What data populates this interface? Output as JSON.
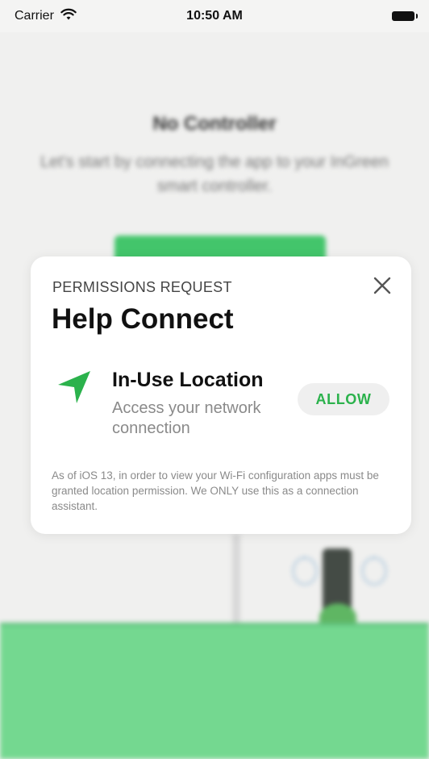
{
  "status_bar": {
    "carrier": "Carrier",
    "time": "10:50 AM",
    "wifi_icon": "wifi-icon",
    "battery_icon": "battery-icon"
  },
  "background": {
    "title": "No Controller",
    "subtitle": "Let's start by connecting the app to your InGreen smart controller."
  },
  "modal": {
    "eyebrow": "PERMISSIONS REQUEST",
    "title": "Help Connect",
    "close_icon": "close-icon",
    "permission": {
      "icon": "location-arrow-icon",
      "title": "In-Use Location",
      "description": "Access your network connection",
      "allow_label": "ALLOW"
    },
    "footnote": "As of iOS 13, in order to view your Wi-Fi configuration apps must be granted location permission. We ONLY use this as a connection assistant."
  },
  "colors": {
    "accent_green": "#2bb24c",
    "ground_green": "#74d890",
    "modal_background": "#ffffff"
  }
}
